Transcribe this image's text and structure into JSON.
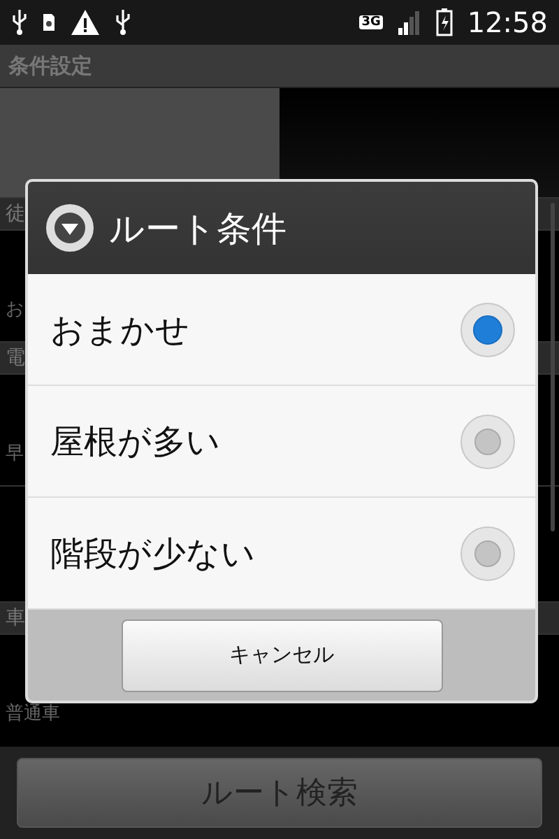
{
  "status_bar": {
    "time": "12:58",
    "network": "3G"
  },
  "title_bar": {
    "title": "条件設定"
  },
  "tabs": [
    {
      "selected": false
    },
    {
      "selected": true
    }
  ],
  "settings_list": [
    {
      "kind": "header",
      "title": "徒"
    },
    {
      "kind": "item",
      "subtitle": "お"
    },
    {
      "kind": "header",
      "title": "電"
    },
    {
      "kind": "item",
      "subtitle": "早"
    },
    {
      "kind": "item2"
    },
    {
      "kind": "header",
      "title": "車"
    },
    {
      "kind": "item",
      "subtitle": "普通車"
    }
  ],
  "search_button": {
    "label": "ルート検索"
  },
  "dialog": {
    "title": "ルート条件",
    "options": [
      {
        "label": "おまかせ",
        "selected": true
      },
      {
        "label": "屋根が多い",
        "selected": false
      },
      {
        "label": "階段が少ない",
        "selected": false
      }
    ],
    "cancel_button": "キャンセル"
  }
}
